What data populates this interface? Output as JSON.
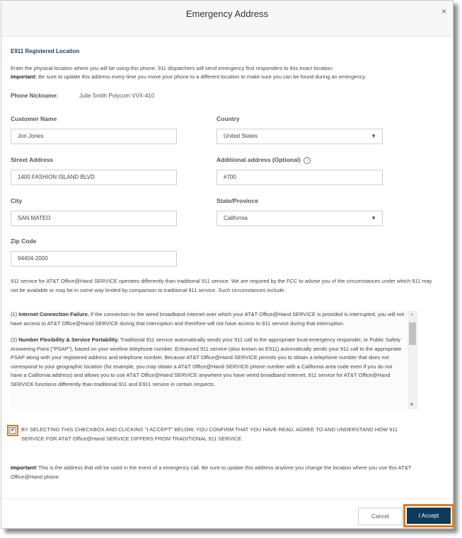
{
  "dialog": {
    "title": "Emergency Address",
    "close_glyph": "×"
  },
  "section": {
    "title": "E911 Registered Location",
    "intro_line1": "Enter the physical location where you will be using this phone. 911 dispatchers will send emergency first responders to this exact location.",
    "intro_important_label": "Important:",
    "intro_line2": " Be sure to update this address every time you move your phone to a different location to make sure you can be found during an emergency."
  },
  "phone": {
    "nickname_label": "Phone Nickname:",
    "nickname_value": "Julie Smith Polycom VVX-410"
  },
  "form": {
    "customer_name": {
      "label": "Customer Name",
      "value": "Jon Jones"
    },
    "country": {
      "label": "Country",
      "value": "United States"
    },
    "street_address": {
      "label": "Street Address",
      "value": "1400 FASHION ISLAND BLVD"
    },
    "additional_address": {
      "label": "Additional address (Optional)",
      "value": "#700",
      "info_glyph": "i"
    },
    "city": {
      "label": "City",
      "value": "SAN MATEO"
    },
    "state": {
      "label": "State/Province",
      "value": "California"
    },
    "zip": {
      "label": "Zip Code",
      "value": "94404-2000"
    },
    "caret_glyph": "▼"
  },
  "disclaimer": "911 service for AT&T Office@Hand SERVICE operates differently than traditional 911 service. We are required by the FCC to advise you of the circumstances under which 911 may not be available or may be in some way limited by comparison to traditional 911 service. Such circumstances include:",
  "terms": [
    {
      "prefix": "(1) ",
      "heading": "Internet Connection Failure.",
      "text": " If the connection to the wired broadband Internet over which your AT&T Office@Hand SERVICE is provided is interrupted, you will not have access to AT&T Office@Hand SERVICE during that interruption and therefore will not have access to 911 service during that interruption."
    },
    {
      "prefix": "(2) ",
      "heading": "Number Flexibility & Service Portability.",
      "text": " Traditional 911 service automatically sends your 911 call to the appropriate local emergency responder, or Public Safety Answering Point (\"PSAP\"), based on your wireline telephone number. Enhanced 911 service (also known as E911) automatically sends your 911 call to the appropriate PSAP along with your registered address and telephone number. Because AT&T Office@Hand SERVICE permits you to obtain a telephone number that does not correspond to your geographic location (for example, you may obtain a AT&T Office@Hand SERVICE phone number with a California area code even if you do not have a California address) and allows you to use AT&T Office@Hand SERVICE anywhere you have wired broadband Internet, 911 service for AT&T Office@Hand SERVICE functions differently than traditional 911 and E911 service in certain respects."
    }
  ],
  "scroll": {
    "up_glyph": "▲",
    "down_glyph": "▼",
    "position": 0.1
  },
  "agreement": {
    "checked": true,
    "check_glyph": "✔",
    "text": "BY SELECTING THIS CHECKBOX AND CLICKING \"I ACCEPT\" BELOW, YOU CONFIRM THAT YOU HAVE READ, AGREE TO AND UNDERSTAND HOW 911 SERVICE FOR AT&T Office@Hand SERVICE DIFFERS FROM TRADITIONAL 911 SERVICE."
  },
  "important_note": {
    "label": "Important!",
    "text": " This is the address that will be used in the event of a emergency call. Be sure to update this address anytime you change the location where you use this AT&T Office@Hand phone."
  },
  "buttons": {
    "cancel": "Cancel",
    "accept": "I Accept"
  },
  "colors": {
    "accent_highlight": "#e07b1a",
    "primary_button": "#0f3a5c"
  }
}
